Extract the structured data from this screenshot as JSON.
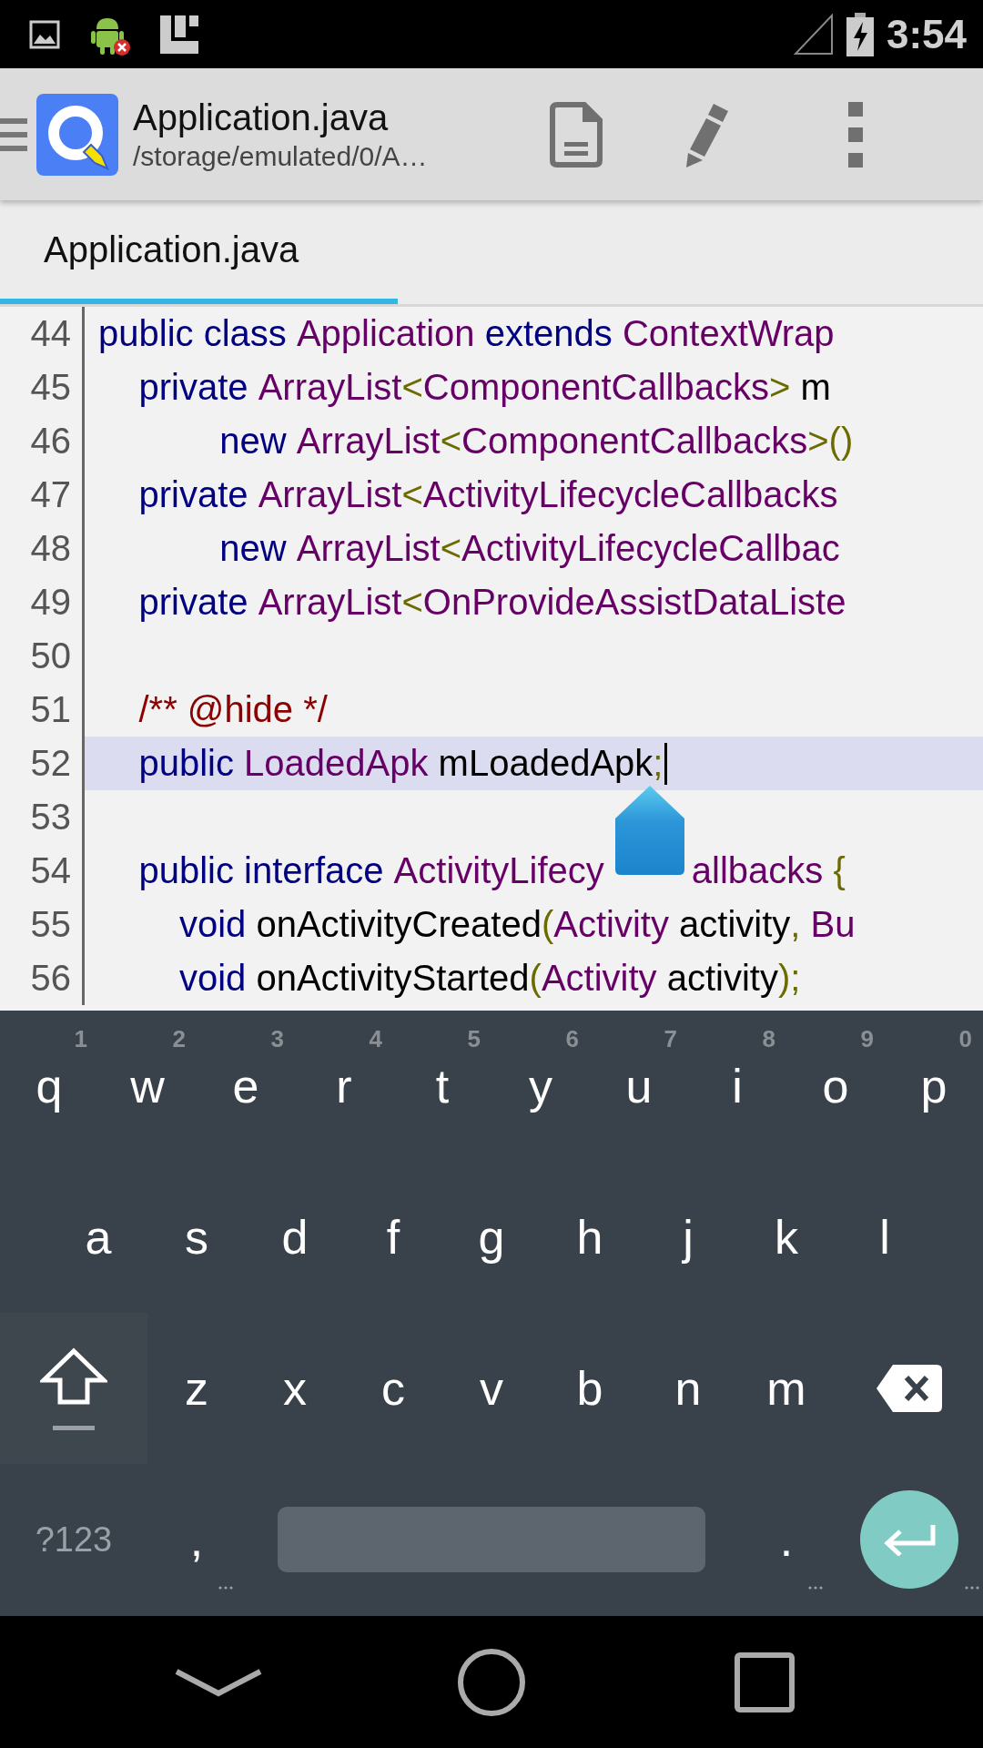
{
  "status_bar": {
    "time": "3:54"
  },
  "toolbar": {
    "title": "Application.java",
    "subtitle": "/storage/emulated/0/A…"
  },
  "tabs": [
    {
      "label": "Application.java",
      "selected": true
    }
  ],
  "editor": {
    "lines": [
      {
        "number": "44",
        "current": false,
        "tokens": [
          {
            "kind": "keyword",
            "text": "public class "
          },
          {
            "kind": "type",
            "text": "Application "
          },
          {
            "kind": "keyword",
            "text": "extends "
          },
          {
            "kind": "type",
            "text": "ContextWrap"
          }
        ]
      },
      {
        "number": "45",
        "current": false,
        "tokens": [
          {
            "kind": "keyword",
            "text": "    private "
          },
          {
            "kind": "type",
            "text": "ArrayList"
          },
          {
            "kind": "punct",
            "text": "<"
          },
          {
            "kind": "type",
            "text": "ComponentCallbacks"
          },
          {
            "kind": "punct",
            "text": "> "
          },
          {
            "kind": "ident",
            "text": "m"
          }
        ]
      },
      {
        "number": "46",
        "current": false,
        "tokens": [
          {
            "kind": "keyword",
            "text": "            new "
          },
          {
            "kind": "type",
            "text": "ArrayList"
          },
          {
            "kind": "punct",
            "text": "<"
          },
          {
            "kind": "type",
            "text": "ComponentCallbacks"
          },
          {
            "kind": "punct",
            "text": ">()"
          }
        ]
      },
      {
        "number": "47",
        "current": false,
        "tokens": [
          {
            "kind": "keyword",
            "text": "    private "
          },
          {
            "kind": "type",
            "text": "ArrayList"
          },
          {
            "kind": "punct",
            "text": "<"
          },
          {
            "kind": "type",
            "text": "ActivityLifecycleCallbacks"
          }
        ]
      },
      {
        "number": "48",
        "current": false,
        "tokens": [
          {
            "kind": "keyword",
            "text": "            new "
          },
          {
            "kind": "type",
            "text": "ArrayList"
          },
          {
            "kind": "punct",
            "text": "<"
          },
          {
            "kind": "type",
            "text": "ActivityLifecycleCallbac"
          }
        ]
      },
      {
        "number": "49",
        "current": false,
        "tokens": [
          {
            "kind": "keyword",
            "text": "    private "
          },
          {
            "kind": "type",
            "text": "ArrayList"
          },
          {
            "kind": "punct",
            "text": "<"
          },
          {
            "kind": "type",
            "text": "OnProvideAssistDataListe"
          }
        ]
      },
      {
        "number": "50",
        "current": false
      },
      {
        "number": "51",
        "current": false,
        "tokens": [
          {
            "kind": "comment",
            "text": "    /** @hide */"
          }
        ]
      },
      {
        "number": "52",
        "current": true,
        "tokens": [
          {
            "kind": "keyword",
            "text": "    public "
          },
          {
            "kind": "type",
            "text": "LoadedApk "
          },
          {
            "kind": "ident",
            "text": "mLoadedApk"
          },
          {
            "kind": "punct",
            "text": ";"
          }
        ]
      },
      {
        "number": "53",
        "current": false
      },
      {
        "number": "54",
        "current": false,
        "tokens": [
          {
            "kind": "keyword",
            "text": "    public interface "
          },
          {
            "kind": "type",
            "text": "ActivityLifecy"
          },
          {
            "kind": "covered"
          },
          {
            "kind": "type",
            "text": "allbacks "
          },
          {
            "kind": "punct",
            "text": "{"
          }
        ]
      },
      {
        "number": "55",
        "current": false,
        "tokens": [
          {
            "kind": "keyword",
            "text": "        void "
          },
          {
            "kind": "ident",
            "text": "onActivityCreated"
          },
          {
            "kind": "punct",
            "text": "("
          },
          {
            "kind": "type",
            "text": "Activity "
          },
          {
            "kind": "ident",
            "text": "activity"
          },
          {
            "kind": "punct",
            "text": ", "
          },
          {
            "kind": "type",
            "text": "Bu"
          }
        ]
      },
      {
        "number": "56",
        "current": false,
        "tokens": [
          {
            "kind": "keyword",
            "text": "        void "
          },
          {
            "kind": "ident",
            "text": "onActivityStarted"
          },
          {
            "kind": "punct",
            "text": "("
          },
          {
            "kind": "type",
            "text": "Activity "
          },
          {
            "kind": "ident",
            "text": "activity"
          },
          {
            "kind": "punct",
            "text": ");"
          }
        ]
      }
    ]
  },
  "keyboard": {
    "rows": [
      {
        "keys": [
          {
            "kind": "letter",
            "label": "q",
            "hint": "1"
          },
          {
            "kind": "letter",
            "label": "w",
            "hint": "2"
          },
          {
            "kind": "letter",
            "label": "e",
            "hint": "3"
          },
          {
            "kind": "letter",
            "label": "r",
            "hint": "4"
          },
          {
            "kind": "letter",
            "label": "t",
            "hint": "5"
          },
          {
            "kind": "letter",
            "label": "y",
            "hint": "6"
          },
          {
            "kind": "letter",
            "label": "u",
            "hint": "7"
          },
          {
            "kind": "letter",
            "label": "i",
            "hint": "8"
          },
          {
            "kind": "letter",
            "label": "o",
            "hint": "9"
          },
          {
            "kind": "letter",
            "label": "p",
            "hint": "0"
          }
        ]
      },
      {
        "keys": [
          {
            "kind": "letter",
            "label": "a"
          },
          {
            "kind": "letter",
            "label": "s"
          },
          {
            "kind": "letter",
            "label": "d"
          },
          {
            "kind": "letter",
            "label": "f"
          },
          {
            "kind": "letter",
            "label": "g"
          },
          {
            "kind": "letter",
            "label": "h"
          },
          {
            "kind": "letter",
            "label": "j"
          },
          {
            "kind": "letter",
            "label": "k"
          },
          {
            "kind": "letter",
            "label": "l"
          }
        ]
      },
      {
        "keys": [
          {
            "kind": "shift"
          },
          {
            "kind": "letter",
            "label": "z"
          },
          {
            "kind": "letter",
            "label": "x"
          },
          {
            "kind": "letter",
            "label": "c"
          },
          {
            "kind": "letter",
            "label": "v"
          },
          {
            "kind": "letter",
            "label": "b"
          },
          {
            "kind": "letter",
            "label": "n"
          },
          {
            "kind": "letter",
            "label": "m"
          },
          {
            "kind": "backspace"
          }
        ]
      },
      {
        "keys": [
          {
            "kind": "symbols",
            "label": "?123"
          },
          {
            "kind": "punct",
            "label": ","
          },
          {
            "kind": "space"
          },
          {
            "kind": "punct",
            "label": "."
          },
          {
            "kind": "enter"
          }
        ]
      }
    ]
  }
}
